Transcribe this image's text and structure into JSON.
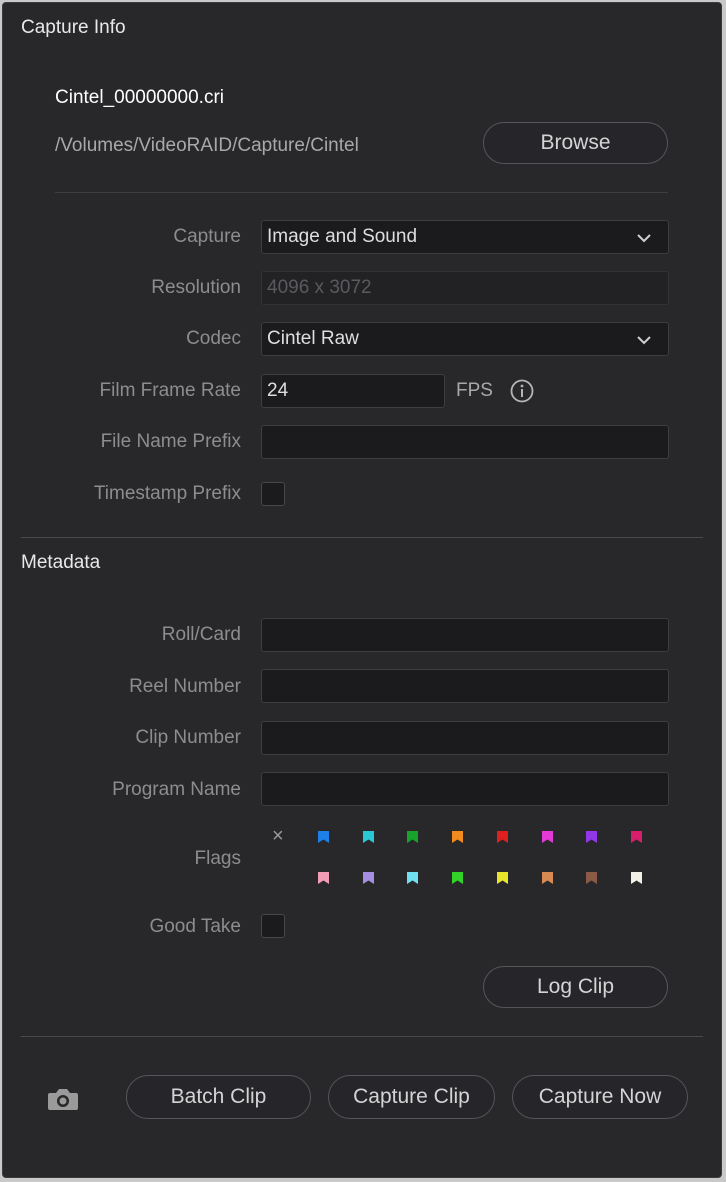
{
  "capture_info": {
    "title": "Capture Info",
    "filename": "Cintel_00000000.cri",
    "path": "/Volumes/VideoRAID/Capture/Cintel",
    "browse_label": "Browse",
    "fields": {
      "capture_label": "Capture",
      "capture_value": "Image and Sound",
      "resolution_label": "Resolution",
      "resolution_value": "4096 x 3072",
      "codec_label": "Codec",
      "codec_value": "Cintel Raw",
      "frame_rate_label": "Film Frame Rate",
      "frame_rate_value": "24",
      "fps_label": "FPS",
      "prefix_label": "File Name Prefix",
      "prefix_value": "",
      "timestamp_label": "Timestamp Prefix",
      "timestamp_checked": false
    }
  },
  "metadata": {
    "title": "Metadata",
    "roll_label": "Roll/Card",
    "roll_value": "",
    "reel_label": "Reel Number",
    "reel_value": "",
    "clip_label": "Clip Number",
    "clip_value": "",
    "program_label": "Program Name",
    "program_value": "",
    "flags_label": "Flags",
    "clear_flag": "×",
    "flag_colors_row1": [
      "#1e7fe8",
      "#27c8d4",
      "#17a32b",
      "#f08b1e",
      "#e0201e",
      "#e23ad6",
      "#9237e6",
      "#d81e6a"
    ],
    "flag_colors_row2": [
      "#f29cb6",
      "#a58de0",
      "#6fe0f0",
      "#32d427",
      "#e8e52a",
      "#d88a52",
      "#8a5a44",
      "#f2efe6"
    ],
    "good_take_label": "Good Take",
    "good_take_checked": false,
    "log_clip_label": "Log Clip"
  },
  "footer": {
    "camera_icon": "camera-icon",
    "batch_clip_label": "Batch Clip",
    "capture_clip_label": "Capture Clip",
    "capture_now_label": "Capture Now"
  }
}
